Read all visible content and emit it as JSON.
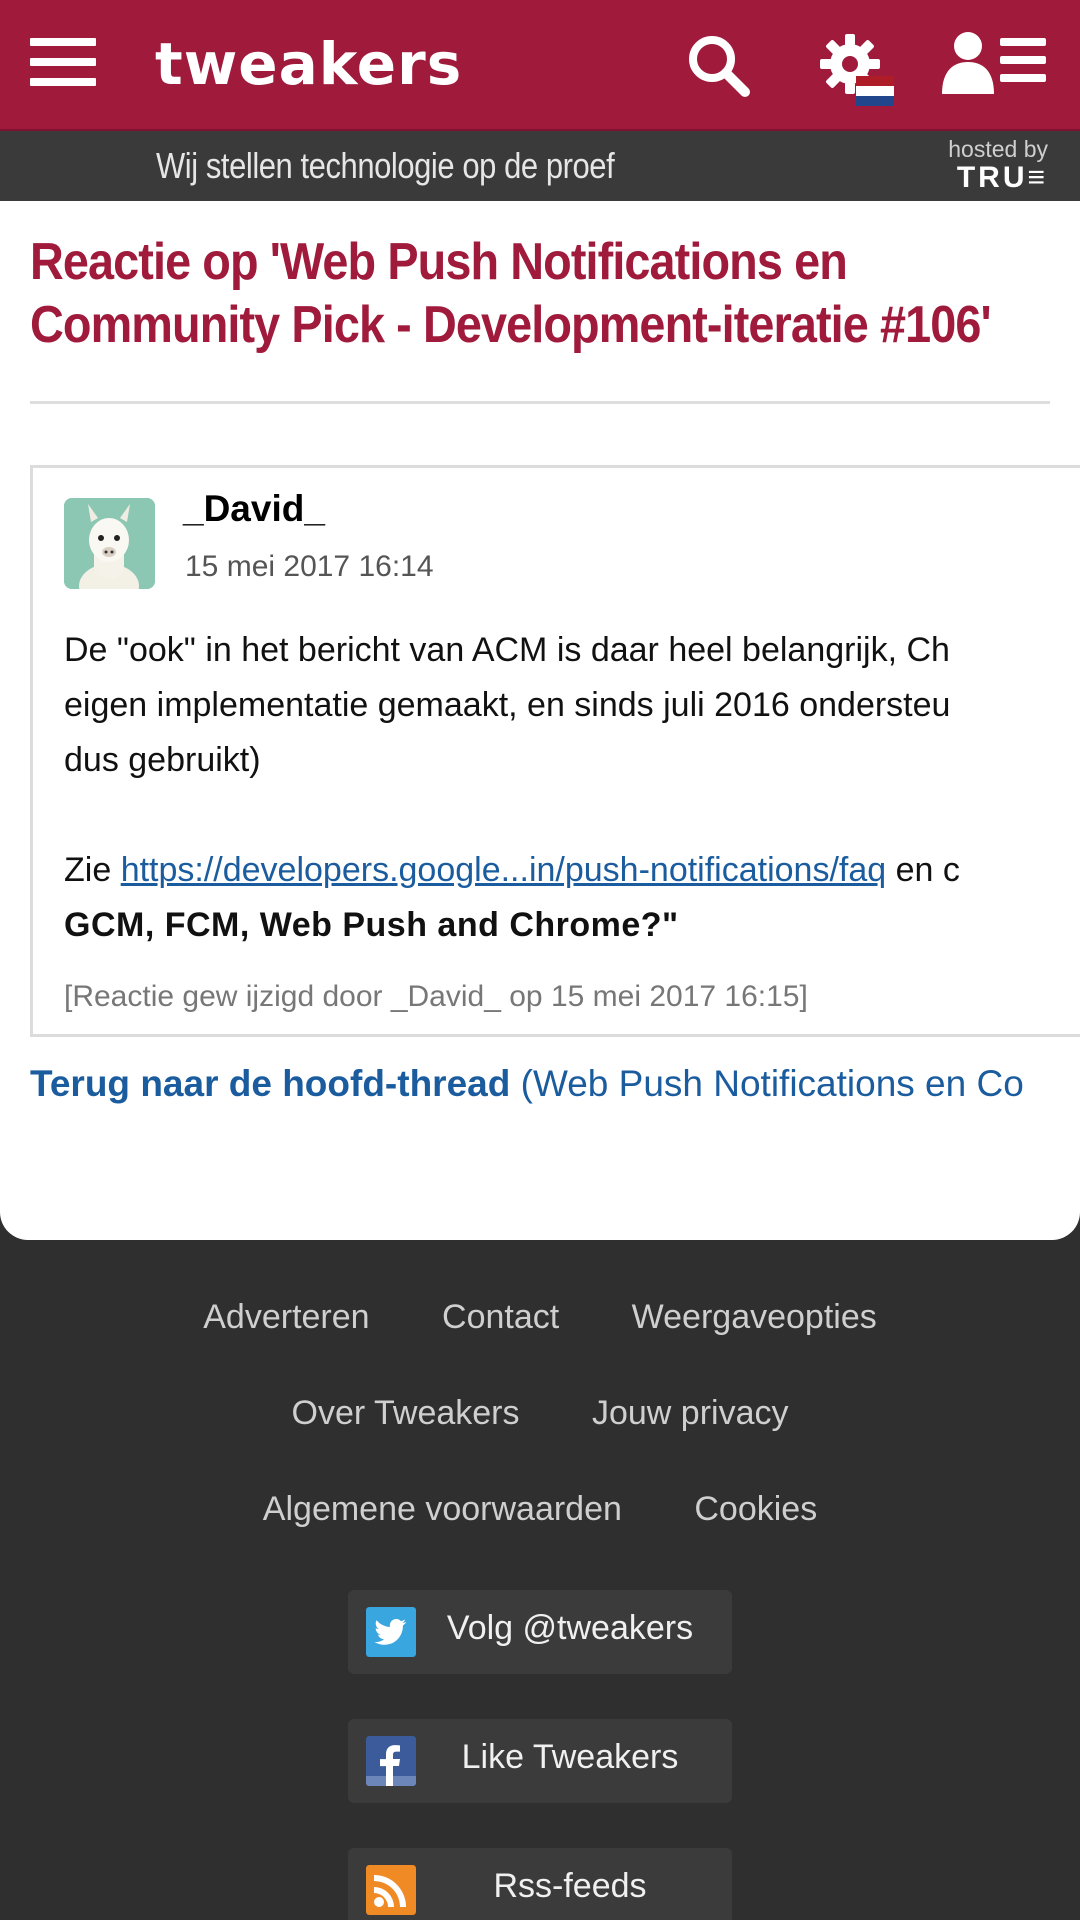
{
  "header": {
    "logo": "tweakers",
    "tagline": "Wij stellen technologie op de proef",
    "hosted_by_label": "hosted by",
    "hosted_by_brand": "TRU≡",
    "colors": {
      "brand": "#a01a3b",
      "subbar": "#3a3a3a"
    },
    "icons": [
      "menu-icon",
      "search-icon",
      "gear-icon",
      "netherlands-flag-icon",
      "user-menu-icon"
    ]
  },
  "main": {
    "title": "Reactie op 'Web Push Notifications en Community Pick - Development-iteratie #106'",
    "reaction": {
      "username": "_David_",
      "date": "15 mei 2017 16:14",
      "paragraph_lines": [
        "De \"ook\" in het bericht van ACM is daar heel belangrijk, Ch",
        "eigen implementatie gemaakt, en sinds juli 2016 ondersteu",
        "dus gebruikt)"
      ],
      "see_prefix": "Zie ",
      "link_text": "https://developers.google...in/push-notifications/faq",
      "see_suffix": " en c",
      "bold_line": "GCM, FCM, Web Push and Chrome?\"",
      "edit_note": "[Reactie gew ijzigd door _David_ op 15 mei 2017 16:15]"
    },
    "back_link_bold": "Terug naar de hoofd-thread",
    "back_link_rest": " (Web Push Notifications en Co"
  },
  "footer": {
    "row1": [
      "Adverteren",
      "Contact",
      "Weergaveopties"
    ],
    "row2": [
      "Over Tweakers",
      "Jouw privacy"
    ],
    "row3": [
      "Algemene voorwaarden",
      "Cookies"
    ],
    "twitter": "Volg @tweakers",
    "facebook": "Like Tweakers",
    "rss": "Rss-feeds"
  }
}
